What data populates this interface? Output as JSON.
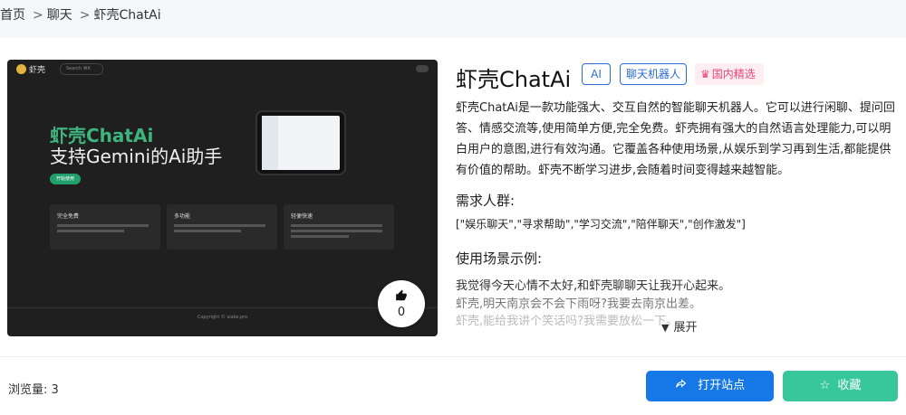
{
  "breadcrumb": {
    "home": "首页",
    "chat": "聊天",
    "current": "虾壳ChatAi",
    "sep": ">"
  },
  "preview": {
    "logo": "虾壳",
    "search_placeholder": "Search",
    "search_shortcut": "⌘K",
    "headline_1": "虾壳ChatAi",
    "headline_2": "支持Gemini的Ai助手",
    "cta": "开始使用",
    "features": [
      {
        "title": "完全免费"
      },
      {
        "title": "多功能"
      },
      {
        "title": "轻便快速"
      }
    ],
    "footer": "Copyright © siake.pro"
  },
  "like": {
    "count": "0"
  },
  "tool": {
    "title": "虾壳ChatAi",
    "tags": [
      "AI",
      "聊天机器人"
    ],
    "premium": "国内精选",
    "description": "虾壳ChatAi是一款功能强大、交互自然的智能聊天机器人。它可以进行闲聊、提问回答、情感交流等,使用简单方便,完全免费。虾壳拥有强大的自然语言处理能力,可以明白用户的意图,进行有效沟通。它覆盖各种使用场景,从娱乐到学习再到生活,都能提供有价值的帮助。虾壳不断学习进步,会随着时间变得越来越智能。",
    "audience_heading": "需求人群:",
    "audience": "[\"娱乐聊天\",\"寻求帮助\",\"学习交流\",\"陪伴聊天\",\"创作激发\"]",
    "examples_heading": "使用场景示例:",
    "examples": [
      "我觉得今天心情不太好,和虾壳聊聊天让我开心起来。",
      "虾壳,明天南京会不会下雨呀?我要去南京出差。",
      "虾壳,能给我讲个笑话吗?我需要放松一下。"
    ],
    "expand": "展开"
  },
  "footer": {
    "views_label": "浏览量:",
    "views": "3",
    "open_site": "打开站点",
    "favorite": "收藏"
  },
  "colors": {
    "primary": "#1677e6",
    "favorite": "#38c79b",
    "premium": "#e9457b"
  }
}
